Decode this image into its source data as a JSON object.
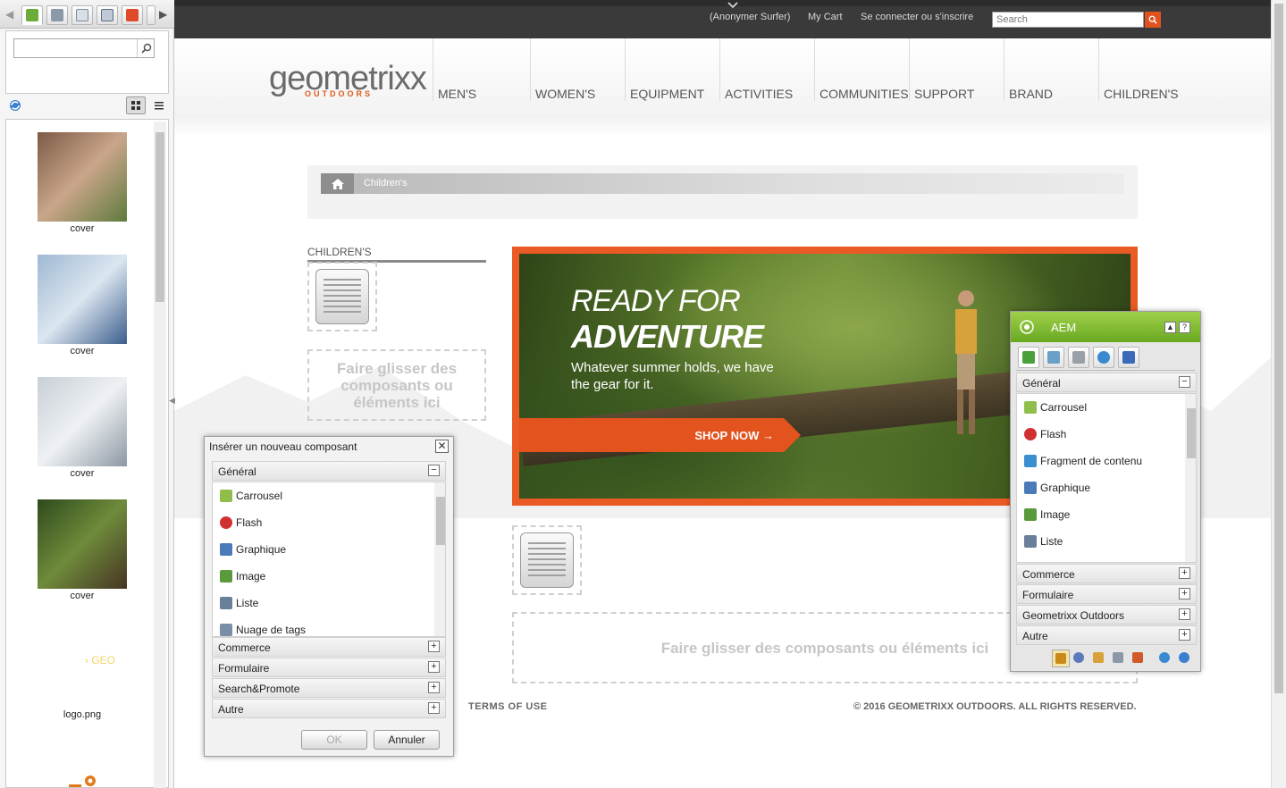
{
  "finder": {
    "tabs": [
      "image-icon",
      "document-icon",
      "page-icon",
      "paragraph-icon",
      "movie-icon",
      "s7-icon"
    ],
    "search": {
      "value": "",
      "placeholder": ""
    },
    "assets": [
      {
        "label": "cover",
        "colors": [
          "#7d5a46",
          "#c9a58a",
          "#5e7a3c"
        ]
      },
      {
        "label": "cover",
        "colors": [
          "#9fb8d3",
          "#dbe6f0",
          "#3b5d8c"
        ]
      },
      {
        "label": "cover",
        "colors": [
          "#c8cfd6",
          "#eef1f4",
          "#8d98a3"
        ]
      },
      {
        "label": "cover",
        "colors": [
          "#2f4a1d",
          "#6e8b3a",
          "#463424"
        ]
      },
      {
        "label": "logo.png",
        "colors": [
          "#ffffff",
          "#ffffff",
          "#ffffff"
        ],
        "text": "› GEO"
      }
    ]
  },
  "topbar": {
    "user": "(Anonymer Surfer)",
    "cart": "My Cart",
    "login": "Se connecter ou s'inscrire",
    "search_placeholder": "Search"
  },
  "brand": {
    "name": "geometrixx",
    "sub": "OUTDOORS"
  },
  "nav": [
    "MEN'S",
    "WOMEN'S",
    "EQUIPMENT",
    "ACTIVITIES",
    "COMMUNITIES",
    "SUPPORT",
    "BRAND",
    "CHILDREN'S"
  ],
  "breadcrumb": {
    "current": "Children's"
  },
  "sidebar_title": "CHILDREN'S",
  "dropzone_text": "Faire glisser des composants ou éléments ici",
  "hero": {
    "line1": "READY FOR",
    "line2": "ADVENTURE",
    "subtitle": "Whatever summer holds, we have the gear for it.",
    "cta": "SHOP NOW →"
  },
  "footer": {
    "terms": "TERMS OF USE",
    "copyright": "© 2016 GEOMETRIXX OUTDOORS. ALL RIGHTS RESERVED."
  },
  "insert_dialog": {
    "title": "Insérer un nouveau composant",
    "group_open": "Général",
    "items": [
      {
        "label": "Carrousel",
        "icon": "carousel-icon",
        "color": "#8fbf4a"
      },
      {
        "label": "Flash",
        "icon": "flash-icon",
        "color": "#d03030"
      },
      {
        "label": "Graphique",
        "icon": "chart-icon",
        "color": "#4a7ab8"
      },
      {
        "label": "Image",
        "icon": "image-icon",
        "color": "#5a9a3a"
      },
      {
        "label": "Liste",
        "icon": "list-icon",
        "color": "#6a7f9a"
      },
      {
        "label": "Nuage de tags",
        "icon": "tag-cloud-icon",
        "color": "#7a8ea8"
      }
    ],
    "groups": [
      "Commerce",
      "Formulaire",
      "Search&Promote",
      "Autre"
    ],
    "ok": "OK",
    "cancel": "Annuler"
  },
  "sidekick": {
    "title": "AEM",
    "group_open": "Général",
    "items": [
      {
        "label": "Carrousel",
        "icon": "carousel-icon",
        "color": "#8fbf4a"
      },
      {
        "label": "Flash",
        "icon": "flash-icon",
        "color": "#d03030"
      },
      {
        "label": "Fragment de contenu",
        "icon": "content-fragment-icon",
        "color": "#3a8fd0"
      },
      {
        "label": "Graphique",
        "icon": "chart-icon",
        "color": "#4a7ab8"
      },
      {
        "label": "Image",
        "icon": "image-icon",
        "color": "#5a9a3a"
      },
      {
        "label": "Liste",
        "icon": "list-icon",
        "color": "#6a7f9a"
      }
    ],
    "groups": [
      "Commerce",
      "Formulaire",
      "Geometrixx Outdoors",
      "Autre"
    ]
  },
  "colors": {
    "accent": "#e0521f",
    "sidekick_green": "#7bb52e"
  }
}
